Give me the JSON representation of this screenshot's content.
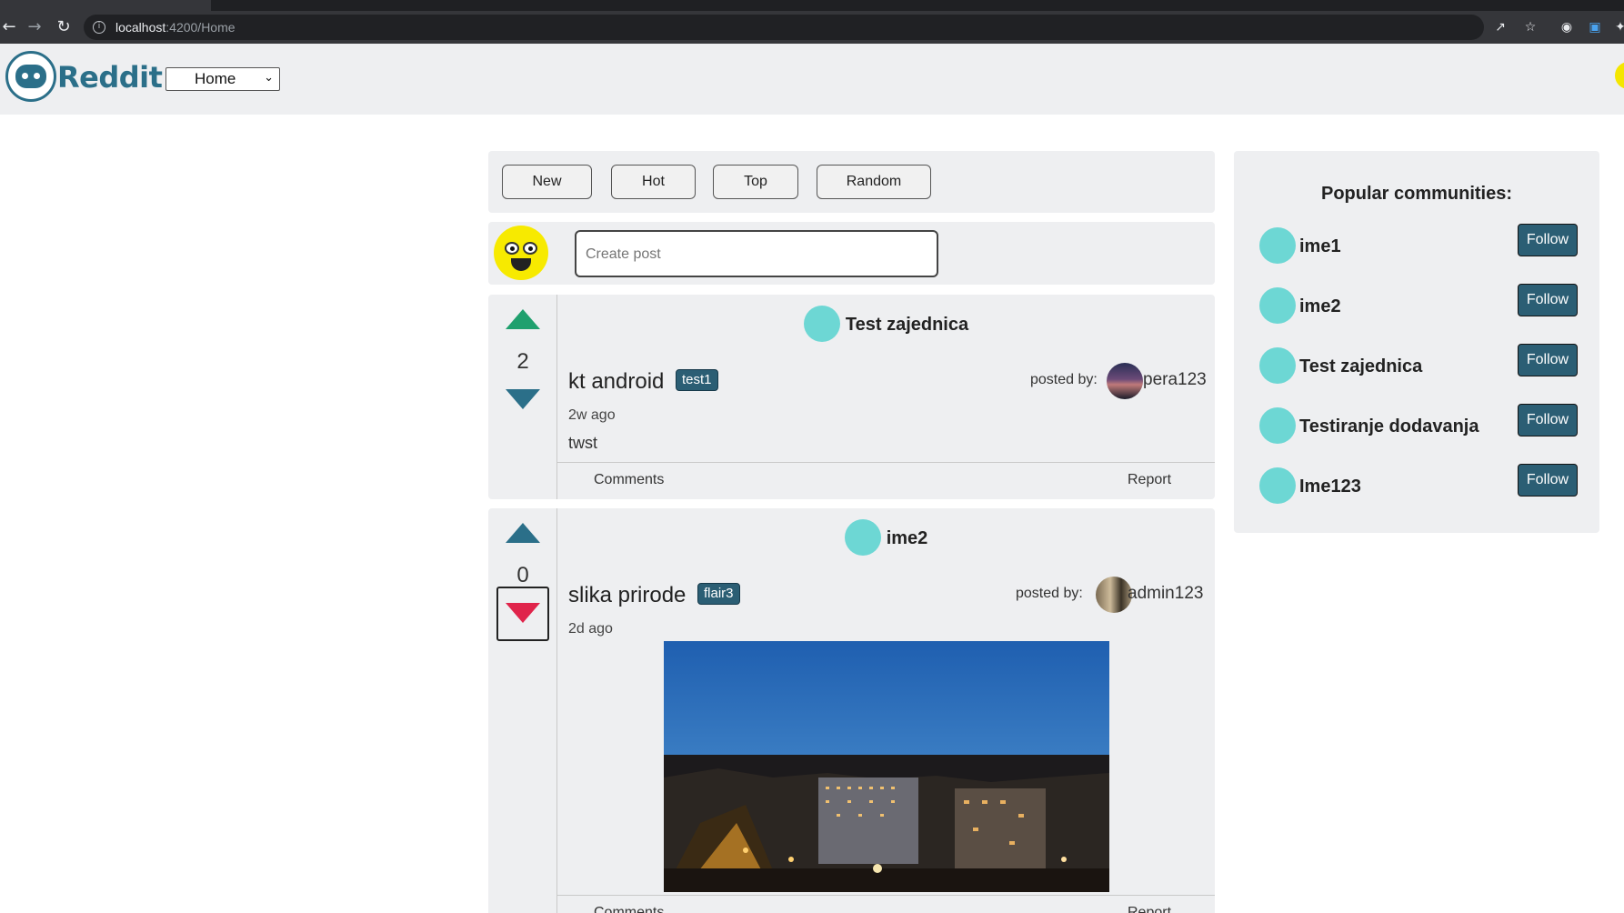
{
  "browser": {
    "url_host": "localhost",
    "url_rest": ":4200/Home"
  },
  "header": {
    "logo_text": "Reddit",
    "nav_select_value": "Home"
  },
  "sort": {
    "buttons": [
      "New",
      "Hot",
      "Top",
      "Random"
    ]
  },
  "create_post": {
    "placeholder": "Create post"
  },
  "posts": [
    {
      "community": "Test zajednica",
      "votes": "2",
      "title": "kt android",
      "flair": "test1",
      "posted_by_label": "posted by:",
      "author": "pera123",
      "time_ago": "2w ago",
      "body": "twst",
      "comments_label": "Comments",
      "report_label": "Report",
      "vote_state": "upvoted"
    },
    {
      "community": "ime2",
      "votes": "0",
      "title": "slika prirode",
      "flair": "flair3",
      "posted_by_label": "posted by:",
      "author": "admin123",
      "time_ago": "2d ago",
      "comments_label": "Comments",
      "report_label": "Report",
      "vote_state": "downvoted"
    }
  ],
  "sidebar": {
    "title": "Popular communities:",
    "follow_label": "Follow",
    "communities": [
      "ime1",
      "ime2",
      "Test zajednica",
      "Testiranje dodavanja",
      "Ime123"
    ]
  },
  "colors": {
    "accent": "#2b5e74",
    "upvote_active": "#1fa06e",
    "downvote_active": "#e0244b",
    "community_dot": "#6dd7d4",
    "panel_bg": "#eeeff1"
  }
}
